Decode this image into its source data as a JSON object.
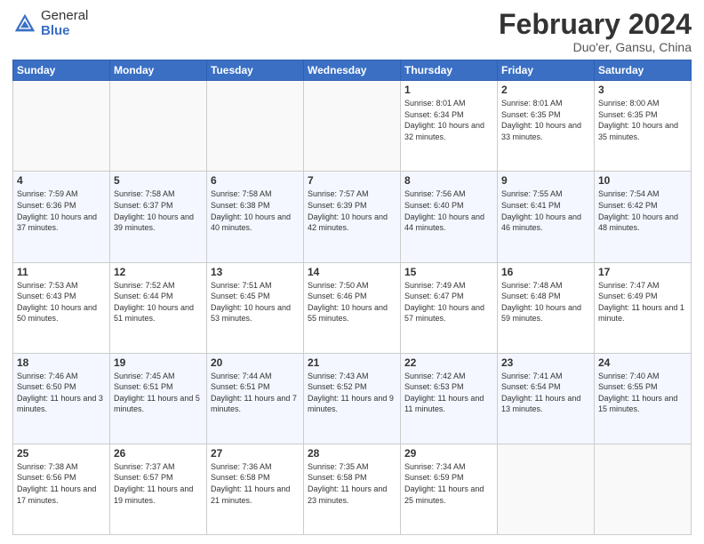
{
  "header": {
    "logo_general": "General",
    "logo_blue": "Blue",
    "month_title": "February 2024",
    "subtitle": "Duo'er, Gansu, China"
  },
  "days_of_week": [
    "Sunday",
    "Monday",
    "Tuesday",
    "Wednesday",
    "Thursday",
    "Friday",
    "Saturday"
  ],
  "weeks": [
    [
      {
        "day": "",
        "info": ""
      },
      {
        "day": "",
        "info": ""
      },
      {
        "day": "",
        "info": ""
      },
      {
        "day": "",
        "info": ""
      },
      {
        "day": "1",
        "info": "Sunrise: 8:01 AM\nSunset: 6:34 PM\nDaylight: 10 hours\nand 32 minutes."
      },
      {
        "day": "2",
        "info": "Sunrise: 8:01 AM\nSunset: 6:35 PM\nDaylight: 10 hours\nand 33 minutes."
      },
      {
        "day": "3",
        "info": "Sunrise: 8:00 AM\nSunset: 6:35 PM\nDaylight: 10 hours\nand 35 minutes."
      }
    ],
    [
      {
        "day": "4",
        "info": "Sunrise: 7:59 AM\nSunset: 6:36 PM\nDaylight: 10 hours\nand 37 minutes."
      },
      {
        "day": "5",
        "info": "Sunrise: 7:58 AM\nSunset: 6:37 PM\nDaylight: 10 hours\nand 39 minutes."
      },
      {
        "day": "6",
        "info": "Sunrise: 7:58 AM\nSunset: 6:38 PM\nDaylight: 10 hours\nand 40 minutes."
      },
      {
        "day": "7",
        "info": "Sunrise: 7:57 AM\nSunset: 6:39 PM\nDaylight: 10 hours\nand 42 minutes."
      },
      {
        "day": "8",
        "info": "Sunrise: 7:56 AM\nSunset: 6:40 PM\nDaylight: 10 hours\nand 44 minutes."
      },
      {
        "day": "9",
        "info": "Sunrise: 7:55 AM\nSunset: 6:41 PM\nDaylight: 10 hours\nand 46 minutes."
      },
      {
        "day": "10",
        "info": "Sunrise: 7:54 AM\nSunset: 6:42 PM\nDaylight: 10 hours\nand 48 minutes."
      }
    ],
    [
      {
        "day": "11",
        "info": "Sunrise: 7:53 AM\nSunset: 6:43 PM\nDaylight: 10 hours\nand 50 minutes."
      },
      {
        "day": "12",
        "info": "Sunrise: 7:52 AM\nSunset: 6:44 PM\nDaylight: 10 hours\nand 51 minutes."
      },
      {
        "day": "13",
        "info": "Sunrise: 7:51 AM\nSunset: 6:45 PM\nDaylight: 10 hours\nand 53 minutes."
      },
      {
        "day": "14",
        "info": "Sunrise: 7:50 AM\nSunset: 6:46 PM\nDaylight: 10 hours\nand 55 minutes."
      },
      {
        "day": "15",
        "info": "Sunrise: 7:49 AM\nSunset: 6:47 PM\nDaylight: 10 hours\nand 57 minutes."
      },
      {
        "day": "16",
        "info": "Sunrise: 7:48 AM\nSunset: 6:48 PM\nDaylight: 10 hours\nand 59 minutes."
      },
      {
        "day": "17",
        "info": "Sunrise: 7:47 AM\nSunset: 6:49 PM\nDaylight: 11 hours\nand 1 minute."
      }
    ],
    [
      {
        "day": "18",
        "info": "Sunrise: 7:46 AM\nSunset: 6:50 PM\nDaylight: 11 hours\nand 3 minutes."
      },
      {
        "day": "19",
        "info": "Sunrise: 7:45 AM\nSunset: 6:51 PM\nDaylight: 11 hours\nand 5 minutes."
      },
      {
        "day": "20",
        "info": "Sunrise: 7:44 AM\nSunset: 6:51 PM\nDaylight: 11 hours\nand 7 minutes."
      },
      {
        "day": "21",
        "info": "Sunrise: 7:43 AM\nSunset: 6:52 PM\nDaylight: 11 hours\nand 9 minutes."
      },
      {
        "day": "22",
        "info": "Sunrise: 7:42 AM\nSunset: 6:53 PM\nDaylight: 11 hours\nand 11 minutes."
      },
      {
        "day": "23",
        "info": "Sunrise: 7:41 AM\nSunset: 6:54 PM\nDaylight: 11 hours\nand 13 minutes."
      },
      {
        "day": "24",
        "info": "Sunrise: 7:40 AM\nSunset: 6:55 PM\nDaylight: 11 hours\nand 15 minutes."
      }
    ],
    [
      {
        "day": "25",
        "info": "Sunrise: 7:38 AM\nSunset: 6:56 PM\nDaylight: 11 hours\nand 17 minutes."
      },
      {
        "day": "26",
        "info": "Sunrise: 7:37 AM\nSunset: 6:57 PM\nDaylight: 11 hours\nand 19 minutes."
      },
      {
        "day": "27",
        "info": "Sunrise: 7:36 AM\nSunset: 6:58 PM\nDaylight: 11 hours\nand 21 minutes."
      },
      {
        "day": "28",
        "info": "Sunrise: 7:35 AM\nSunset: 6:58 PM\nDaylight: 11 hours\nand 23 minutes."
      },
      {
        "day": "29",
        "info": "Sunrise: 7:34 AM\nSunset: 6:59 PM\nDaylight: 11 hours\nand 25 minutes."
      },
      {
        "day": "",
        "info": ""
      },
      {
        "day": "",
        "info": ""
      }
    ]
  ]
}
